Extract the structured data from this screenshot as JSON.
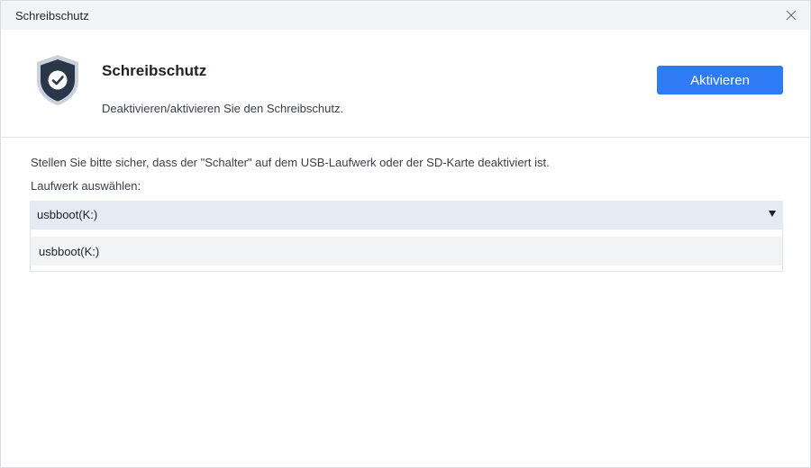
{
  "window": {
    "title": "Schreibschutz",
    "close_icon": "close-icon"
  },
  "header": {
    "icon": "shield-check-icon",
    "title": "Schreibschutz",
    "subtitle": "Deaktivieren/aktivieren Sie den Schreibschutz.",
    "activate_label": "Aktivieren"
  },
  "body": {
    "info": "Stellen Sie bitte sicher, dass der \"Schalter\" auf dem USB-Laufwerk oder der SD-Karte deaktiviert ist.",
    "drive_label": "Laufwerk auswählen:",
    "selected_drive": "usbboot(K:)",
    "options": [
      "usbboot(K:)"
    ]
  },
  "colors": {
    "accent": "#2f7bf5",
    "shield_dark": "#2b3648",
    "select_bg": "#e6ebf3",
    "titlebar_bg": "#f3f4f6"
  }
}
